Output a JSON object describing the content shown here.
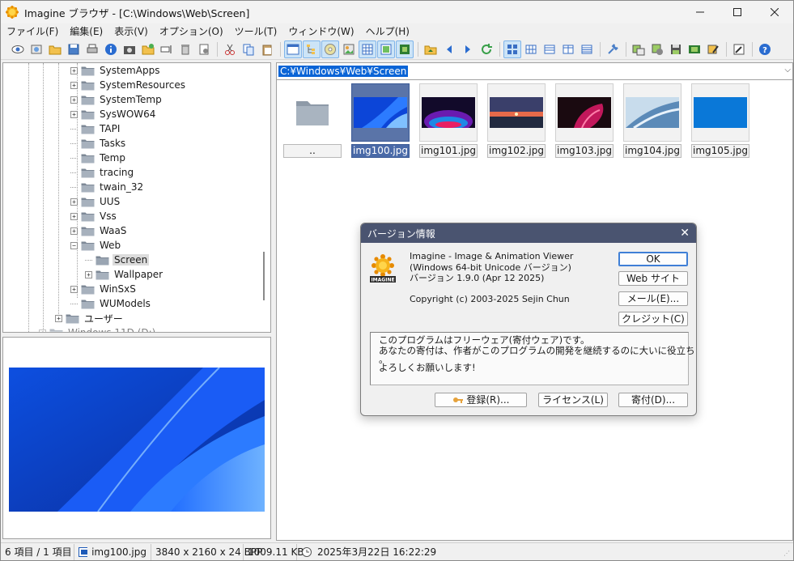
{
  "window": {
    "title": "Imagine ブラウザ - [C:\\Windows\\Web\\Screen]",
    "minimize_icon": "minimize-icon",
    "maximize_icon": "maximize-icon",
    "close_icon": "close-icon"
  },
  "menu": [
    "ファイル(F)",
    "編集(E)",
    "表示(V)",
    "オプション(O)",
    "ツール(T)",
    "ウィンドウ(W)",
    "ヘルプ(H)"
  ],
  "tree": {
    "items": [
      {
        "label": "SystemApps",
        "expandable": true
      },
      {
        "label": "SystemResources",
        "expandable": true
      },
      {
        "label": "SystemTemp",
        "expandable": true
      },
      {
        "label": "SysWOW64",
        "expandable": true
      },
      {
        "label": "TAPI",
        "expandable": false
      },
      {
        "label": "Tasks",
        "expandable": false
      },
      {
        "label": "Temp",
        "expandable": false
      },
      {
        "label": "tracing",
        "expandable": false
      },
      {
        "label": "twain_32",
        "expandable": false
      },
      {
        "label": "UUS",
        "expandable": true
      },
      {
        "label": "Vss",
        "expandable": true
      },
      {
        "label": "WaaS",
        "expandable": true
      },
      {
        "label": "Web",
        "expandable": true,
        "expanded": true
      },
      {
        "label": "Screen",
        "expandable": false,
        "selected": true
      },
      {
        "label": "Wallpaper",
        "expandable": true
      },
      {
        "label": "WinSxS",
        "expandable": true
      },
      {
        "label": "WUModels",
        "expandable": false
      },
      {
        "label": "ユーザー",
        "expandable": true
      },
      {
        "label": "Windows 11D (D:)",
        "expandable": true
      }
    ]
  },
  "address": {
    "path": "C:¥Windows¥Web¥Screen"
  },
  "thumbnails": [
    {
      "name": "..",
      "kind": "folder"
    },
    {
      "name": "img100.jpg",
      "selected": true
    },
    {
      "name": "img101.jpg"
    },
    {
      "name": "img102.jpg"
    },
    {
      "name": "img103.jpg"
    },
    {
      "name": "img104.jpg"
    },
    {
      "name": "img105.jpg"
    }
  ],
  "dialog": {
    "title": "バージョン情報",
    "line1": "Imagine - Image & Animation Viewer",
    "line2": "(Windows 64-bit Unicode バージョン)",
    "line3": "バージョン 1.9.0 (Apr 12 2025)",
    "copyright": "Copyright (c) 2003-2025 Sejin Chun",
    "buttons": {
      "ok": "OK",
      "web": "Web サイト",
      "mail": "メール(E)...",
      "credit": "クレジット(C)",
      "register": "登録(R)...",
      "license": "ライセンス(L)",
      "donate": "寄付(D)..."
    },
    "message": [
      "このプログラムはフリーウェア(寄付ウェア)です。",
      "あなたの寄付は、作者がこのプログラムの開発を継続するのに大いに役立ちます",
      "。",
      "よろしくお願いします!"
    ]
  },
  "status": {
    "count": "6 項目 / 1 項目",
    "file": "img100.jpg",
    "dims": "3840 x 2160 x 24 BPP",
    "size": "1009.11 KB",
    "date": "2025年3月22日 16:22:29"
  }
}
